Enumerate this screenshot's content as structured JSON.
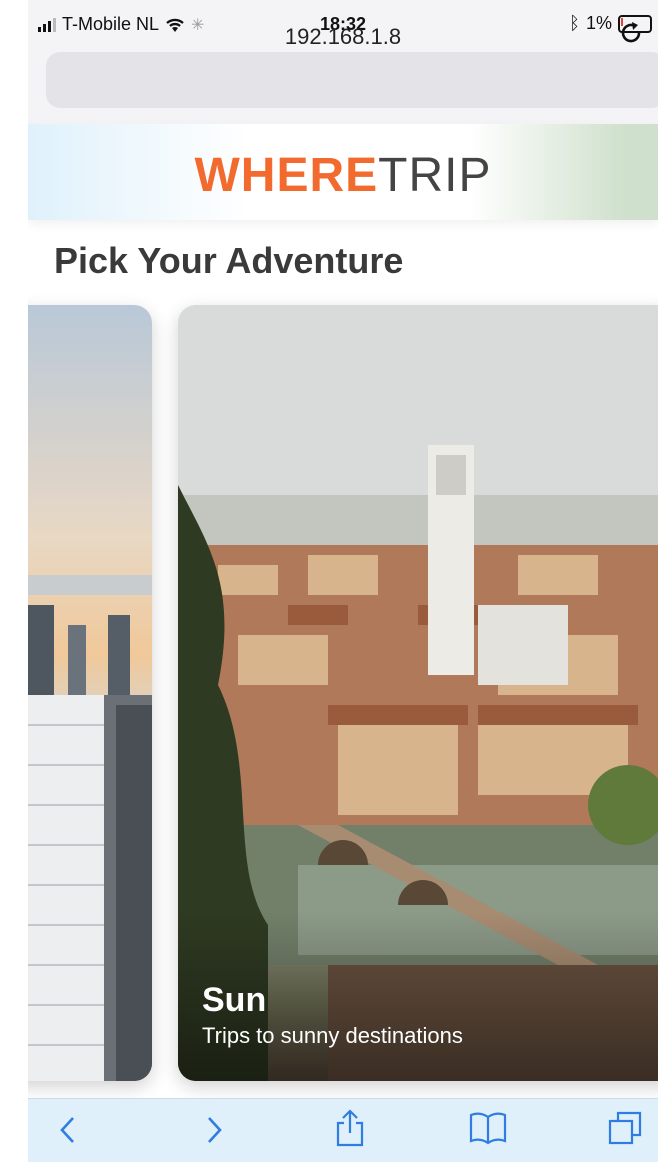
{
  "status": {
    "carrier": "T-Mobile NL",
    "time": "18:32",
    "battery": "1%",
    "icons": [
      "signal-icon",
      "wifi-icon",
      "loading-icon",
      "bluetooth-icon",
      "battery-icon"
    ]
  },
  "browser": {
    "url": "192.168.1.8",
    "reload_icon": "reload-icon"
  },
  "site": {
    "logo_bold": "WHERE",
    "logo_light": "TRIP",
    "brand_color": "#f26a2e"
  },
  "page": {
    "title": "Pick Your Adventure"
  },
  "cards": [
    {
      "title": "",
      "subtitle": ""
    },
    {
      "title": "Sun",
      "subtitle": "Trips to sunny destinations"
    }
  ],
  "toolbar": {
    "items": [
      "back-icon",
      "forward-icon",
      "share-icon",
      "bookmarks-icon",
      "tabs-icon"
    ],
    "accent": "#2f7de1"
  }
}
